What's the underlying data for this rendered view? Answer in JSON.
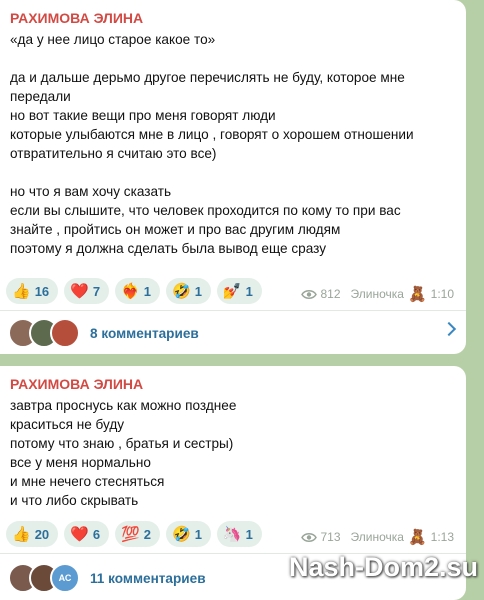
{
  "messages": [
    {
      "author": "РАХИМОВА ЭЛИНА",
      "lines": [
        "«да у нее лицо старое какое то»",
        "",
        "да и дальше дерьмо другое перечислять не буду, которое мне",
        "передали",
        "но вот такие вещи про меня говорят люди",
        "которые улыбаются мне в лицо , говорят о хорошем отношении",
        "отвратительно я считаю это все)",
        "",
        "но что я вам хочу сказать",
        "если вы слышите, что человек проходится по кому то при вас",
        "знайте , пройтись он может и про вас другим людям",
        "поэтому я должна сделать была вывод еще сразу"
      ],
      "reactions": [
        {
          "emoji": "👍",
          "count": "16"
        },
        {
          "emoji": "❤️",
          "count": "7"
        },
        {
          "emoji": "❤‍🔥",
          "count": "1"
        },
        {
          "emoji": "🤣",
          "count": "1"
        },
        {
          "emoji": "💅",
          "count": "1"
        }
      ],
      "views": "812",
      "signature": "Элиночка",
      "signature_emoji": "🧸",
      "time": "1:10",
      "comments_label": "8 комментариев"
    },
    {
      "author": "РАХИМОВА ЭЛИНА",
      "lines": [
        "завтра проснусь как можно позднее",
        "краситься не буду",
        "потому что знаю , братья и сестры)",
        "все у меня нормально",
        "и мне нечего стесняться",
        "и что либо скрывать"
      ],
      "reactions": [
        {
          "emoji": "👍",
          "count": "20"
        },
        {
          "emoji": "❤️",
          "count": "6"
        },
        {
          "emoji": "💯",
          "count": "2"
        },
        {
          "emoji": "🤣",
          "count": "1"
        },
        {
          "emoji": "🦄",
          "count": "1"
        }
      ],
      "views": "713",
      "signature": "Элиночка",
      "signature_emoji": "🧸",
      "time": "1:13",
      "avatar_initials": "АС",
      "comments_label": "11 комментариев"
    }
  ],
  "watermark": "Nash-Dom2.su",
  "colors": {
    "background": "#b7cfa6",
    "author": "#d24a43",
    "link": "#2c6f9b",
    "reaction_chip": "#e4efe9"
  }
}
